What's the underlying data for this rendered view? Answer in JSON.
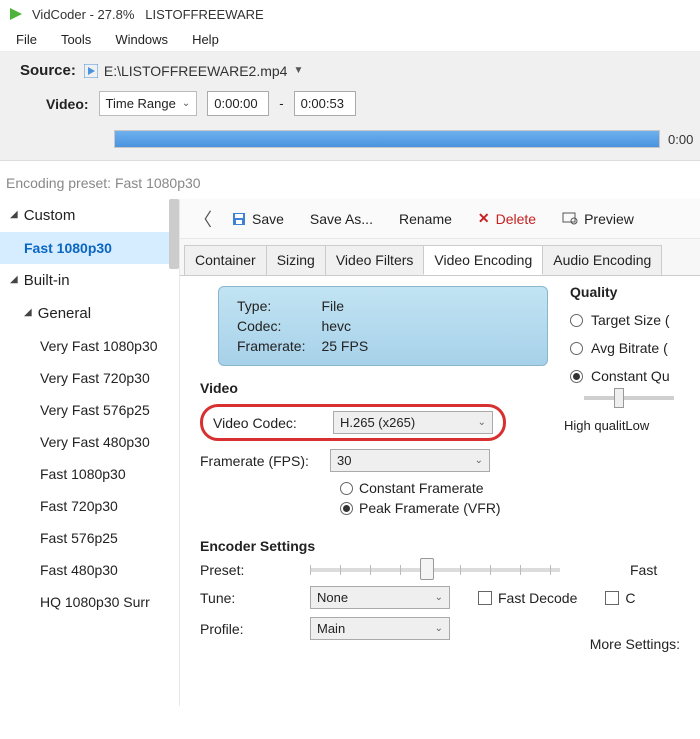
{
  "titlebar": {
    "app": "VidCoder",
    "percent": "27.8%",
    "doc": "LISTOFFREEWARE"
  },
  "menubar": [
    "File",
    "Tools",
    "Windows",
    "Help"
  ],
  "source": {
    "label": "Source:",
    "path": "E:\\LISTOFFREEWARE2.mp4"
  },
  "video_row": {
    "label": "Video:",
    "mode": "Time Range",
    "start": "0:00:00",
    "end": "0:00:53"
  },
  "progress": {
    "percent": 100,
    "right_label": "0:00"
  },
  "preset_line": "Encoding preset: Fast 1080p30",
  "sidebar": {
    "custom": {
      "label": "Custom",
      "items": [
        "Fast 1080p30"
      ]
    },
    "builtin": {
      "label": "Built-in",
      "general": {
        "label": "General",
        "items": [
          "Very Fast 1080p30",
          "Very Fast 720p30",
          "Very Fast 576p25",
          "Very Fast 480p30",
          "Fast 1080p30",
          "Fast 720p30",
          "Fast 576p25",
          "Fast 480p30",
          "HQ 1080p30 Surr"
        ]
      }
    }
  },
  "content_toolbar": {
    "save": "Save",
    "save_as": "Save As...",
    "rename": "Rename",
    "delete": "Delete",
    "preview": "Preview"
  },
  "tabs": [
    "Container",
    "Sizing",
    "Video Filters",
    "Video Encoding",
    "Audio Encoding"
  ],
  "active_tab": "Video Encoding",
  "info_box": {
    "type_label": "Type:",
    "type_value": "File",
    "codec_label": "Codec:",
    "codec_value": "hevc",
    "fr_label": "Framerate:",
    "fr_value": "25 FPS"
  },
  "video_section": {
    "heading": "Video",
    "codec_label": "Video Codec:",
    "codec_value": "H.265 (x265)",
    "fr_label": "Framerate (FPS):",
    "fr_value": "30",
    "cfr": "Constant Framerate",
    "pfr": "Peak Framerate (VFR)"
  },
  "quality": {
    "heading": "Quality",
    "target": "Target Size (",
    "avg": "Avg Bitrate (",
    "cq": "Constant Qu",
    "caption": "High qualitLow"
  },
  "encoder": {
    "heading": "Encoder Settings",
    "preset_label": "Preset:",
    "preset_speed": "Fast",
    "tune_label": "Tune:",
    "tune_value": "None",
    "fast_decode": "Fast Decode",
    "partial_checkbox": "C",
    "profile_label": "Profile:",
    "profile_value": "Main",
    "more": "More Settings:"
  }
}
